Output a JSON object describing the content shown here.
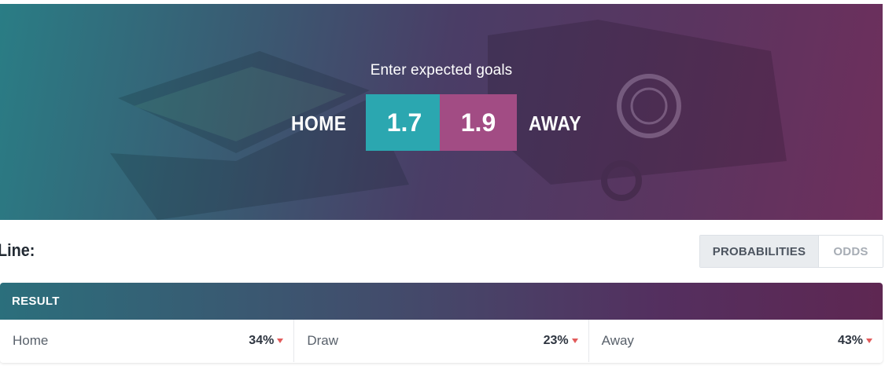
{
  "hero": {
    "title": "Enter expected goals",
    "home_label": "HOME",
    "away_label": "AWAY",
    "home_xg": "1.7",
    "away_xg": "1.9"
  },
  "line": {
    "label": "Line:"
  },
  "toggle": {
    "probabilities": "PROBABILITIES",
    "odds": "ODDS",
    "selected": "PROBABILITIES"
  },
  "result": {
    "header": "RESULT",
    "cells": [
      {
        "label": "Home",
        "value": "34%"
      },
      {
        "label": "Draw",
        "value": "23%"
      },
      {
        "label": "Away",
        "value": "43%"
      }
    ]
  },
  "colors": {
    "home_accent": "#2ba7b0",
    "away_accent": "#a24c84",
    "down_caret": "#e25b5b"
  }
}
